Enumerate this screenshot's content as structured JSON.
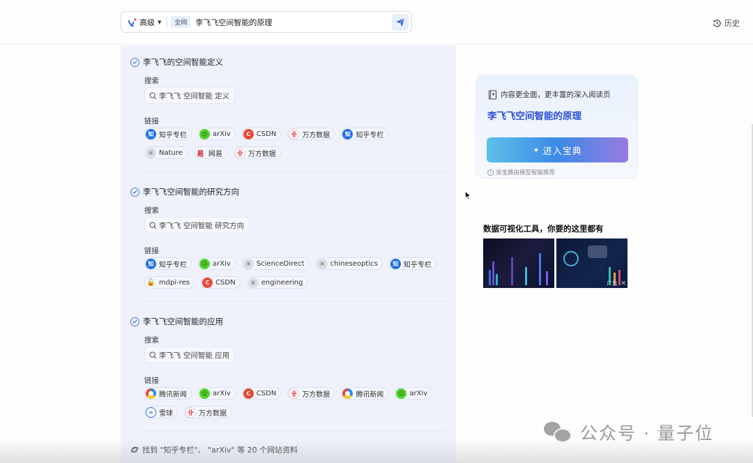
{
  "header": {
    "mode_label": "高级",
    "scope_label": "全网",
    "query": "李飞飞空间智能的原理",
    "history_label": "历史"
  },
  "sections": [
    {
      "title": "李飞飞的空间智能定义",
      "search_label": "搜索",
      "search_query": "李飞飞 空间智能 定义",
      "links_label": "链接",
      "links": [
        {
          "name": "知乎专栏",
          "icon": "zhihu-icon"
        },
        {
          "name": "arXiv",
          "icon": "arxiv-icon"
        },
        {
          "name": "CSDN",
          "icon": "csdn-icon"
        },
        {
          "name": "万方数据",
          "icon": "wanfang-icon"
        },
        {
          "name": "知乎专栏",
          "icon": "zhihu-icon"
        },
        {
          "name": "Nature",
          "icon": "generic-site-icon"
        },
        {
          "name": "网易",
          "icon": "netease-icon"
        },
        {
          "name": "万方数据",
          "icon": "wanfang-icon"
        }
      ]
    },
    {
      "title": "李飞飞空间智能的研究方向",
      "search_label": "搜索",
      "search_query": "李飞飞 空间智能 研究方向",
      "links_label": "链接",
      "links": [
        {
          "name": "知乎专栏",
          "icon": "zhihu-icon"
        },
        {
          "name": "arXiv",
          "icon": "arxiv-icon"
        },
        {
          "name": "ScienceDirect",
          "icon": "generic-site-icon"
        },
        {
          "name": "chineseoptics",
          "icon": "generic-site-icon"
        },
        {
          "name": "知乎专栏",
          "icon": "zhihu-icon"
        },
        {
          "name": "mdpi-res",
          "icon": "unlock-icon"
        },
        {
          "name": "CSDN",
          "icon": "csdn-icon"
        },
        {
          "name": "engineering",
          "icon": "generic-site-icon"
        }
      ]
    },
    {
      "title": "李飞飞空间智能的应用",
      "search_label": "搜索",
      "search_query": "李飞飞 空间智能 应用",
      "links_label": "链接",
      "links": [
        {
          "name": "腾讯新闻",
          "icon": "tencent-news-icon"
        },
        {
          "name": "arXiv",
          "icon": "arxiv-icon"
        },
        {
          "name": "CSDN",
          "icon": "csdn-icon"
        },
        {
          "name": "万方数据",
          "icon": "wanfang-icon"
        },
        {
          "name": "腾讯新闻",
          "icon": "tencent-news-icon"
        },
        {
          "name": "arXiv",
          "icon": "arxiv-icon"
        },
        {
          "name": "雪球",
          "icon": "xueqiu-icon"
        },
        {
          "name": "万方数据",
          "icon": "wanfang-icon"
        }
      ]
    }
  ],
  "footer_note": "找到 \"知乎专栏\"、 \"arXiv\" 等 20 个网站资料",
  "baodian": {
    "header": "内容更全面，更丰富的深入阅读页",
    "title": "李飞飞空间智能的原理",
    "button_label": "进入宝典",
    "note": "该宝典由模型智能推荐"
  },
  "ad": {
    "title": "数据可视化工具，你要的这里都有",
    "badge": "广告",
    "close": "✕"
  },
  "watermark": {
    "text": "公众号 · 量子位"
  },
  "colors": {
    "accent": "#2b4fd4",
    "panel_bg": "#eff2fc",
    "check": "#4b78d8"
  }
}
